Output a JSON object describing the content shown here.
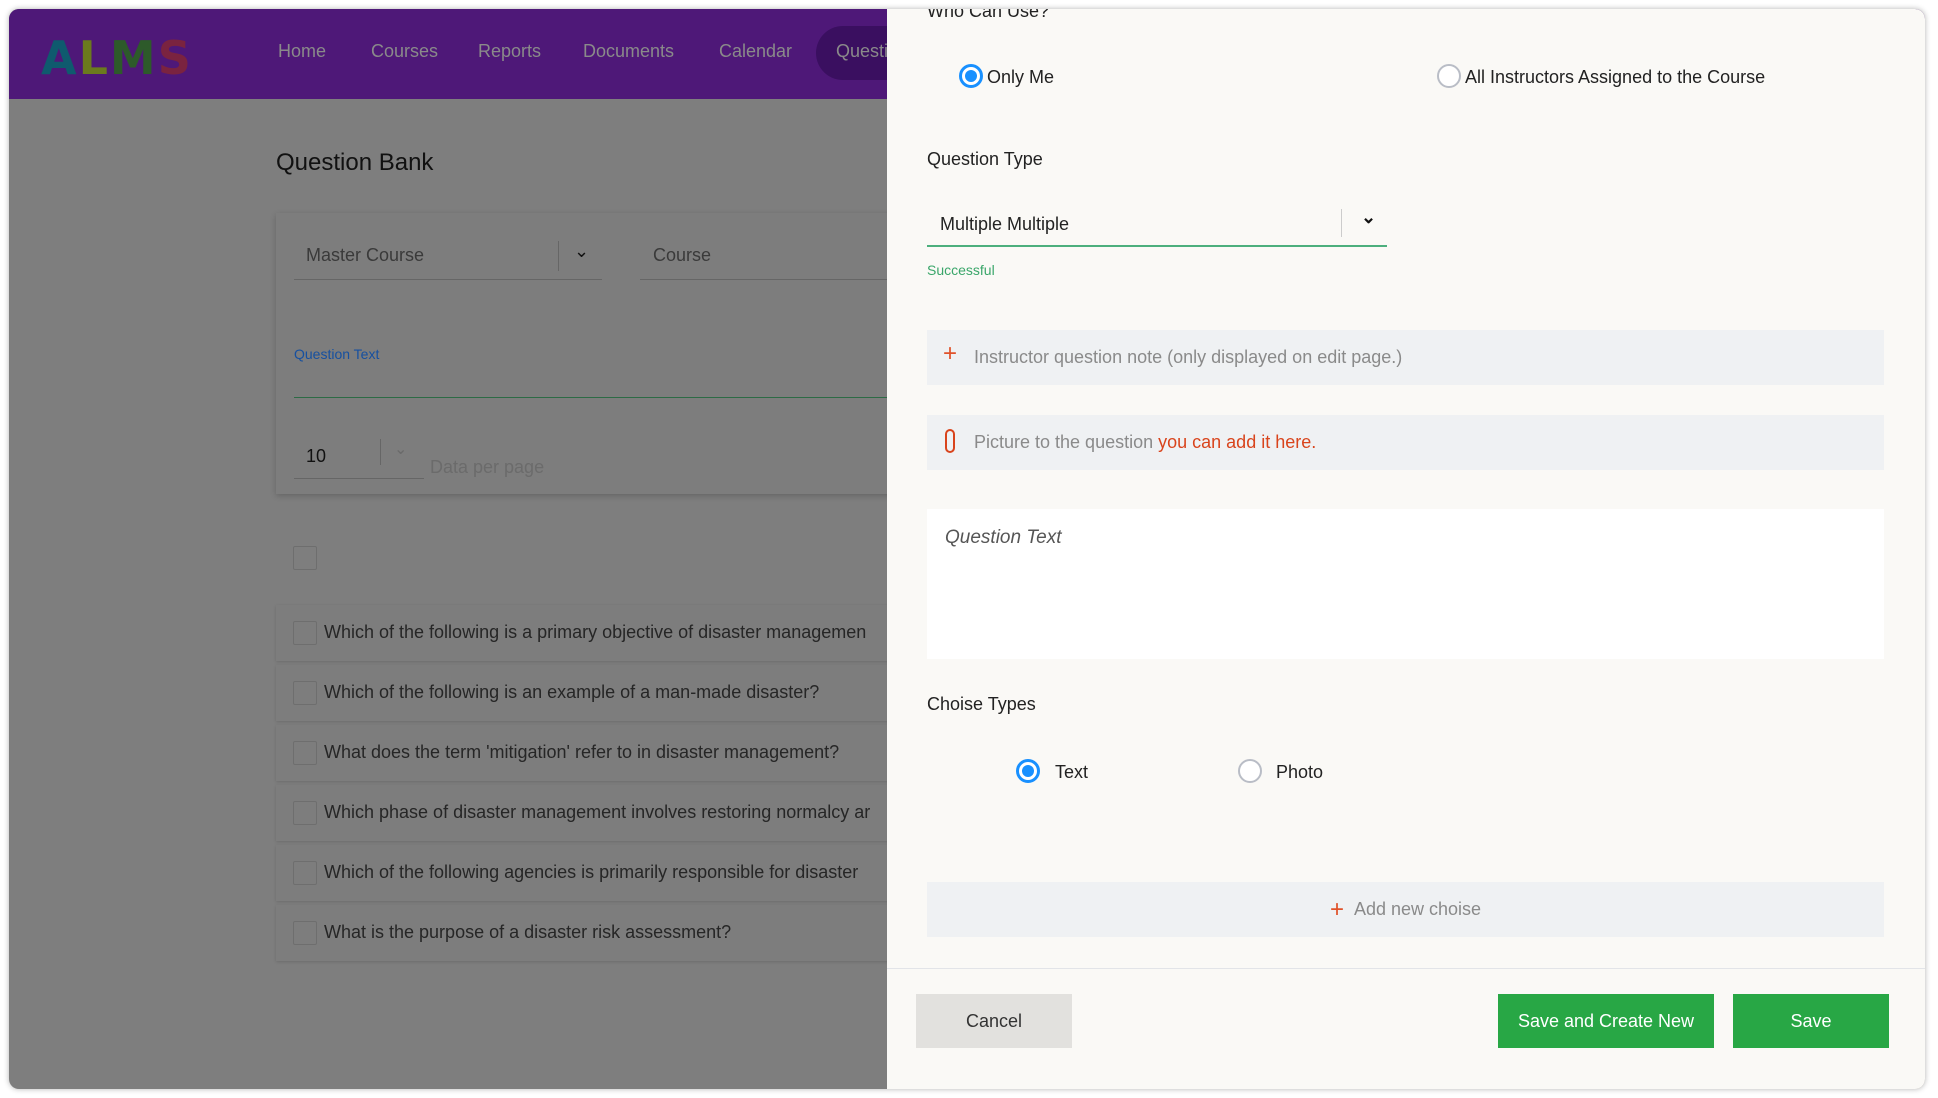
{
  "nav": {
    "logo": "ALMS",
    "items": [
      "Home",
      "Courses",
      "Reports",
      "Documents",
      "Calendar",
      "Questi"
    ]
  },
  "page": {
    "title": "Question Bank",
    "filters": {
      "master_course": "Master Course",
      "course": "Course",
      "question_text_label": "Question Text",
      "per_page": "10",
      "per_page_label": "Data per page"
    },
    "questions": [
      "Which of the following is a primary objective of disaster managemen",
      "Which of the following is an example of a man-made disaster?",
      "What does the term 'mitigation' refer to in disaster management?",
      "Which phase of disaster management involves restoring normalcy ar",
      "Which of the following agencies is primarily responsible for disaster",
      "What is the purpose of a disaster risk assessment?"
    ]
  },
  "panel": {
    "who_can_use": "Who Can Use?",
    "who_options": [
      {
        "label": "Only Me",
        "selected": true
      },
      {
        "label": "All Instructors Assigned to the Course",
        "selected": false
      }
    ],
    "question_type_label": "Question Type",
    "question_type_value": "Multiple Multiple",
    "status": "Successful",
    "note_text": "Instructor question note (only displayed on edit page.)",
    "picture_text": "Picture to the question ",
    "picture_link": "you can add it here.",
    "question_placeholder": "Question Text",
    "choice_types_label": "Choise Types",
    "choice_options": [
      {
        "label": "Text",
        "selected": true
      },
      {
        "label": "Photo",
        "selected": false
      }
    ],
    "add_choice": "Add new choise",
    "cancel": "Cancel",
    "save_new": "Save and Create New",
    "save": "Save"
  },
  "colors": {
    "nav": "#4e1878",
    "accent": "#1890ff",
    "success": "#28a745",
    "link": "#d9441c"
  }
}
